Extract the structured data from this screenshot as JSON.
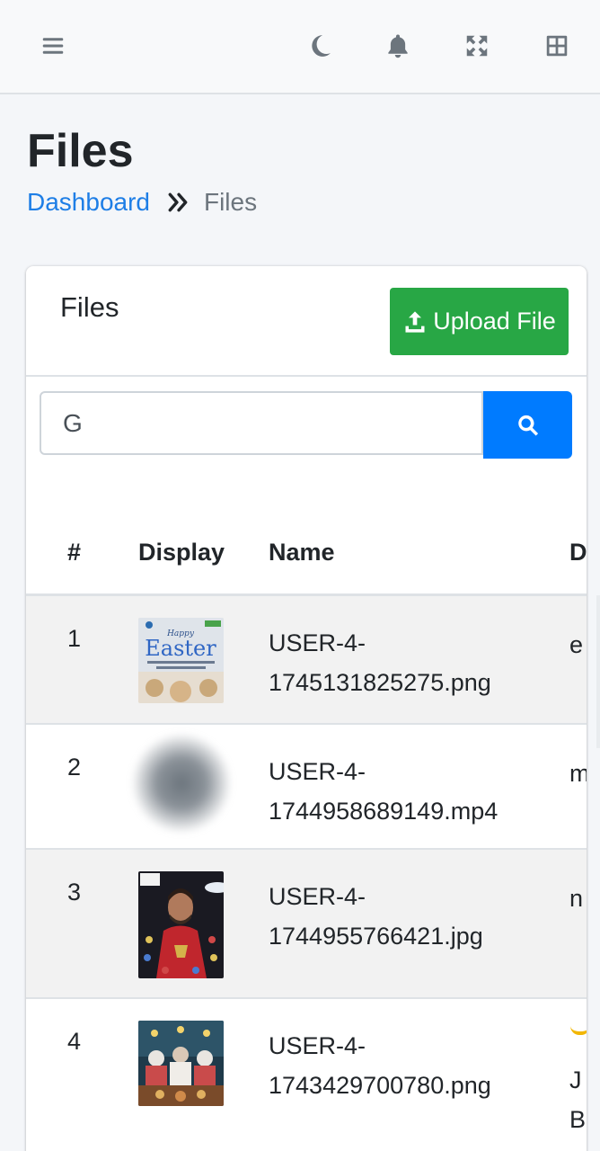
{
  "navbar": {
    "icons": [
      "menu-icon",
      "moon-icon",
      "bell-icon",
      "fullscreen-icon",
      "grid-icon"
    ]
  },
  "page": {
    "title": "Files",
    "breadcrumb": {
      "home": "Dashboard",
      "current": "Files"
    }
  },
  "card": {
    "title": "Files",
    "upload_label": "Upload File",
    "search": {
      "value": "G"
    }
  },
  "table": {
    "columns": [
      "#",
      "Display",
      "Name",
      "D"
    ],
    "rows": [
      {
        "num": "1",
        "name_line1": "USER-4-",
        "name_line2": "1745131825275.png",
        "desc_line1": "e",
        "desc_line2": ""
      },
      {
        "num": "2",
        "name_line1": "USER-4-",
        "name_line2": "1744958689149.mp4",
        "desc_line1": "m",
        "desc_line2": ""
      },
      {
        "num": "3",
        "name_line1": "USER-4-",
        "name_line2": "1744955766421.jpg",
        "desc_line1": "n",
        "desc_line2": ""
      },
      {
        "num": "4",
        "name_line1": "USER-4-",
        "name_line2": "1743429700780.png",
        "desc_line1": "J",
        "desc_line2": "B"
      }
    ],
    "thumbnail_texts": {
      "easter_line1": "Happy",
      "easter_line2": "Easter"
    }
  },
  "colors": {
    "primary": "#007bff",
    "success": "#28a745",
    "link": "#1e7ee6"
  }
}
